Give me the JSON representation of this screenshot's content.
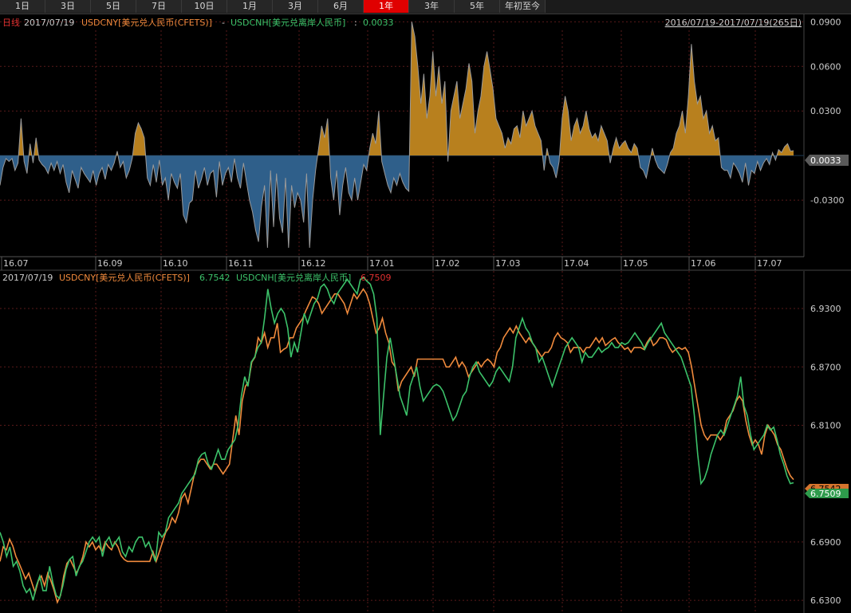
{
  "tabs": [
    "1日",
    "3日",
    "5日",
    "7日",
    "10日",
    "1月",
    "3月",
    "6月",
    "1年",
    "3年",
    "5年",
    "年初至今"
  ],
  "active_tab": "1年",
  "top_panel": {
    "period": "日线",
    "date": "2017/07/19",
    "s1": "USDCNY[美元兑人民币(CFETS)]",
    "minus": "-",
    "s2": "USDCNH[美元兑离岸人民币]",
    "colon": ":",
    "value": "0.0033",
    "range": "2016/07/19-2017/07/19(265日)",
    "current_tag": "0.0033"
  },
  "bottom_panel": {
    "date": "2017/07/19",
    "s1": "USDCNY[美元兑人民币(CFETS)]",
    "v1": "6.7542",
    "s2": "USDCNH[美元兑离岸人民币]",
    "v2": "6.7509",
    "tag1": "6.7542",
    "tag2": "6.7509"
  },
  "colors": {
    "cny": "#f08a3c",
    "cnh": "#3cc26a",
    "pos_fill": "#b8801e",
    "neg_fill": "#2f5f8a",
    "grid": "#5a1a1a",
    "axis_text": "#cccccc",
    "red_text": "#e03030"
  },
  "chart_data": [
    {
      "type": "area",
      "title": "USDCNY[美元兑人民币(CFETS)] - USDCNH[美元兑离岸人民币]",
      "xlabel": "",
      "ylabel": "",
      "x_ticks": [
        "16.07",
        "16.09",
        "16.10",
        "16.11",
        "16.12",
        "17.01",
        "17.02",
        "17.03",
        "17.04",
        "17.05",
        "17.06",
        "17.07"
      ],
      "y_ticks": [
        "0.0900",
        "0.0600",
        "0.0300",
        "0.0033",
        "-0.0300"
      ],
      "ylim": [
        -0.068,
        0.095
      ],
      "grid": true,
      "series": [
        {
          "name": "USDCNY - USDCNH",
          "values": [
            -0.02,
            -0.008,
            -0.002,
            -0.004,
            -0.002,
            -0.01,
            -0.005,
            0.025,
            -0.004,
            -0.012,
            0.008,
            -0.005,
            0.012,
            -0.003,
            -0.006,
            -0.008,
            -0.012,
            -0.005,
            -0.01,
            -0.004,
            -0.012,
            -0.006,
            -0.018,
            -0.025,
            -0.01,
            -0.016,
            -0.022,
            -0.008,
            -0.012,
            -0.015,
            -0.018,
            -0.01,
            -0.02,
            -0.012,
            -0.008,
            -0.016,
            -0.006,
            -0.01,
            -0.005,
            0.003,
            -0.008,
            -0.004,
            -0.015,
            -0.01,
            -0.002,
            0.015,
            0.022,
            0.018,
            0.012,
            -0.015,
            -0.02,
            -0.006,
            -0.018,
            -0.003,
            -0.02,
            -0.015,
            -0.03,
            -0.012,
            -0.018,
            -0.022,
            -0.012,
            -0.04,
            -0.045,
            -0.032,
            -0.03,
            -0.01,
            -0.022,
            -0.016,
            -0.008,
            -0.02,
            -0.012,
            -0.01,
            -0.028,
            -0.004,
            -0.02,
            -0.012,
            -0.008,
            -0.018,
            -0.002,
            -0.015,
            -0.022,
            -0.005,
            -0.018,
            -0.03,
            -0.038,
            -0.05,
            -0.058,
            -0.034,
            -0.02,
            -0.062,
            -0.01,
            -0.048,
            -0.012,
            -0.042,
            -0.052,
            -0.015,
            -0.062,
            -0.02,
            -0.035,
            -0.025,
            -0.03,
            -0.045,
            -0.012,
            -0.062,
            -0.03,
            -0.01,
            0.005,
            0.02,
            0.012,
            0.025,
            -0.015,
            -0.03,
            -0.01,
            -0.04,
            -0.02,
            -0.008,
            -0.025,
            -0.03,
            -0.015,
            -0.03,
            -0.018,
            -0.006,
            -0.01,
            0.005,
            0.015,
            0.008,
            0.03,
            -0.004,
            -0.012,
            -0.02,
            -0.025,
            -0.015,
            -0.02,
            -0.012,
            -0.018,
            -0.022,
            -0.024,
            0.09,
            0.08,
            0.06,
            0.035,
            0.055,
            0.025,
            0.04,
            0.07,
            0.04,
            0.06,
            0.035,
            0.05,
            -0.004,
            0.03,
            0.04,
            0.05,
            0.025,
            0.035,
            0.045,
            0.062,
            0.05,
            0.015,
            0.03,
            0.04,
            0.06,
            0.07,
            0.058,
            0.045,
            0.025,
            0.02,
            0.015,
            0.005,
            0.012,
            0.008,
            0.018,
            0.02,
            0.012,
            0.03,
            0.02,
            0.025,
            0.03,
            0.02,
            0.015,
            0.01,
            -0.01,
            0.005,
            -0.005,
            -0.008,
            -0.015,
            -0.004,
            0.025,
            0.04,
            0.03,
            0.01,
            0.02,
            0.025,
            0.015,
            0.02,
            0.03,
            0.018,
            0.012,
            0.015,
            0.01,
            0.02,
            0.015,
            0.01,
            -0.005,
            0.005,
            0.012,
            0.005,
            0.008,
            0.01,
            0.005,
            0.002,
            0.008,
            0.005,
            -0.008,
            -0.01,
            -0.015,
            -0.005,
            0.005,
            -0.003,
            -0.008,
            -0.01,
            -0.012,
            -0.006,
            0.002,
            0.005,
            0.015,
            0.02,
            0.03,
            0.015,
            0.04,
            0.075,
            0.05,
            0.035,
            0.04,
            0.025,
            0.03,
            0.015,
            0.02,
            0.01,
            0.012,
            -0.008,
            -0.01,
            -0.01,
            -0.015,
            -0.005,
            -0.008,
            -0.012,
            -0.018,
            -0.005,
            -0.02,
            -0.01,
            -0.012,
            -0.004,
            -0.01,
            -0.005,
            -0.002,
            -0.006,
            0.002,
            -0.003,
            0.004,
            0.002,
            0.006,
            0.008,
            0.003,
            0.0033
          ]
        }
      ]
    },
    {
      "type": "line",
      "title": "",
      "xlabel": "",
      "ylabel": "",
      "y_ticks": [
        "6.9300",
        "6.8700",
        "6.8100",
        "6.7509",
        "6.6900",
        "6.6300"
      ],
      "ylim": [
        6.617,
        6.962
      ],
      "grid": true,
      "series": [
        {
          "name": "USDCNY[美元兑人民币(CFETS)]",
          "values": [
            6.67,
            6.685,
            6.682,
            6.693,
            6.686,
            6.675,
            6.668,
            6.66,
            6.652,
            6.658,
            6.648,
            6.638,
            6.65,
            6.655,
            6.645,
            6.658,
            6.65,
            6.64,
            6.628,
            6.635,
            6.655,
            6.668,
            6.672,
            6.665,
            6.658,
            6.665,
            6.675,
            6.69,
            6.685,
            6.69,
            6.682,
            6.686,
            6.68,
            6.69,
            6.685,
            6.682,
            6.69,
            6.685,
            6.676,
            6.672,
            6.67,
            6.67,
            6.67,
            6.67,
            6.67,
            6.67,
            6.67,
            6.67,
            6.68,
            6.67,
            6.68,
            6.69,
            6.7,
            6.705,
            6.715,
            6.71,
            6.72,
            6.735,
            6.74,
            6.73,
            6.745,
            6.76,
            6.77,
            6.775,
            6.775,
            6.77,
            6.765,
            6.77,
            6.77,
            6.765,
            6.76,
            6.765,
            6.77,
            6.795,
            6.82,
            6.8,
            6.835,
            6.85,
            6.855,
            6.875,
            6.88,
            6.9,
            6.895,
            6.905,
            6.89,
            6.9,
            6.9,
            6.915,
            6.885,
            6.888,
            6.89,
            6.9,
            6.9,
            6.91,
            6.915,
            6.92,
            6.928,
            6.935,
            6.942,
            6.94,
            6.935,
            6.925,
            6.93,
            6.935,
            6.94,
            6.945,
            6.945,
            6.94,
            6.935,
            6.925,
            6.935,
            6.945,
            6.94,
            6.945,
            6.95,
            6.945,
            6.935,
            6.92,
            6.905,
            6.91,
            6.92,
            6.905,
            6.895,
            6.875,
            6.87,
            6.845,
            6.855,
            6.86,
            6.865,
            6.87,
            6.86,
            6.878,
            6.878,
            6.878,
            6.878,
            6.878,
            6.878,
            6.878,
            6.878,
            6.878,
            6.87,
            6.87,
            6.875,
            6.88,
            6.87,
            6.875,
            6.87,
            6.86,
            6.865,
            6.87,
            6.875,
            6.87,
            6.875,
            6.878,
            6.875,
            6.87,
            6.885,
            6.89,
            6.9,
            6.905,
            6.91,
            6.905,
            6.912,
            6.905,
            6.9,
            6.895,
            6.9,
            6.895,
            6.89,
            6.885,
            6.88,
            6.885,
            6.885,
            6.89,
            6.9,
            6.905,
            6.9,
            6.898,
            6.895,
            6.885,
            6.89,
            6.89,
            6.89,
            6.885,
            6.89,
            6.89,
            6.895,
            6.9,
            6.895,
            6.9,
            6.892,
            6.895,
            6.898,
            6.9,
            6.895,
            6.892,
            6.888,
            6.89,
            6.885,
            6.89,
            6.89,
            6.89,
            6.888,
            6.895,
            6.9,
            6.892,
            6.895,
            6.9,
            6.9,
            6.898,
            6.89,
            6.885,
            6.888,
            6.89,
            6.888,
            6.89,
            6.885,
            6.87,
            6.85,
            6.83,
            6.81,
            6.8,
            6.795,
            6.8,
            6.8,
            6.8,
            6.795,
            6.8,
            6.815,
            6.82,
            6.825,
            6.835,
            6.84,
            6.835,
            6.815,
            6.8,
            6.79,
            6.795,
            6.79,
            6.78,
            6.8,
            6.81,
            6.805,
            6.8,
            6.79,
            6.785,
            6.775,
            6.765,
            6.758,
            6.7542
          ]
        },
        {
          "name": "USDCNH[美元兑离岸人民币]",
          "values": [
            6.7,
            6.69,
            6.675,
            6.685,
            6.665,
            6.67,
            6.66,
            6.645,
            6.638,
            6.642,
            6.63,
            6.645,
            6.655,
            6.64,
            6.64,
            6.665,
            6.648,
            6.635,
            6.632,
            6.645,
            6.662,
            6.672,
            6.675,
            6.655,
            6.665,
            6.67,
            6.68,
            6.69,
            6.695,
            6.69,
            6.695,
            6.675,
            6.69,
            6.695,
            6.685,
            6.69,
            6.695,
            6.68,
            6.675,
            6.685,
            6.68,
            6.69,
            6.695,
            6.695,
            6.685,
            6.69,
            6.68,
            6.67,
            6.7,
            6.695,
            6.7,
            6.715,
            6.72,
            6.725,
            6.73,
            6.74,
            6.745,
            6.75,
            6.755,
            6.76,
            6.775,
            6.78,
            6.782,
            6.77,
            6.765,
            6.775,
            6.785,
            6.775,
            6.775,
            6.785,
            6.79,
            6.795,
            6.81,
            6.84,
            6.86,
            6.85,
            6.875,
            6.88,
            6.89,
            6.895,
            6.92,
            6.95,
            6.93,
            6.915,
            6.925,
            6.93,
            6.925,
            6.91,
            6.88,
            6.895,
            6.885,
            6.905,
            6.925,
            6.915,
            6.925,
            6.935,
            6.94,
            6.952,
            6.955,
            6.95,
            6.94,
            6.935,
            6.945,
            6.95,
            6.955,
            6.96,
            6.955,
            6.95,
            6.945,
            6.96,
            6.962,
            6.958,
            6.955,
            6.945,
            6.92,
            6.8,
            6.84,
            6.88,
            6.9,
            6.88,
            6.86,
            6.84,
            6.83,
            6.82,
            6.85,
            6.86,
            6.87,
            6.85,
            6.835,
            6.84,
            6.845,
            6.85,
            6.852,
            6.85,
            6.845,
            6.835,
            6.825,
            6.815,
            6.82,
            6.83,
            6.84,
            6.845,
            6.86,
            6.87,
            6.875,
            6.865,
            6.86,
            6.855,
            6.85,
            6.855,
            6.865,
            6.87,
            6.865,
            6.86,
            6.855,
            6.87,
            6.9,
            6.91,
            6.92,
            6.91,
            6.905,
            6.895,
            6.89,
            6.875,
            6.88,
            6.87,
            6.86,
            6.85,
            6.86,
            6.87,
            6.88,
            6.89,
            6.895,
            6.9,
            6.895,
            6.89,
            6.875,
            6.885,
            6.88,
            6.88,
            6.885,
            6.89,
            6.885,
            6.888,
            6.89,
            6.895,
            6.89,
            6.89,
            6.895,
            6.893,
            6.895,
            6.9,
            6.905,
            6.9,
            6.895,
            6.888,
            6.895,
            6.9,
            6.905,
            6.91,
            6.915,
            6.905,
            6.9,
            6.895,
            6.89,
            6.885,
            6.88,
            6.87,
            6.86,
            6.85,
            6.82,
            6.78,
            6.75,
            6.755,
            6.765,
            6.78,
            6.79,
            6.8,
            6.805,
            6.8,
            6.81,
            6.82,
            6.83,
            6.84,
            6.86,
            6.83,
            6.82,
            6.8,
            6.785,
            6.79,
            6.795,
            6.8,
            6.81,
            6.805,
            6.808,
            6.795,
            6.78,
            6.77,
            6.758,
            6.75,
            6.7509
          ]
        }
      ]
    }
  ]
}
